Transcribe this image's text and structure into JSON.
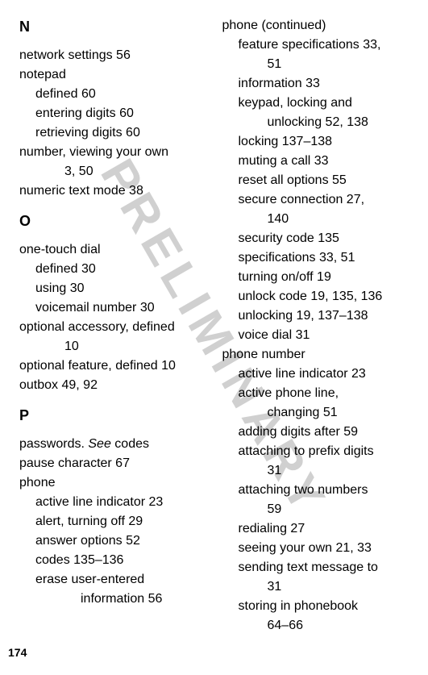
{
  "watermark": "PRELIMINARY",
  "pageNumber": "174",
  "leftColumn": {
    "sectionN": {
      "letter": "N",
      "entries": [
        {
          "text": "network settings  56",
          "class": "entry"
        },
        {
          "text": "notepad",
          "class": "entry"
        },
        {
          "text": "defined  60",
          "class": "sub-entry"
        },
        {
          "text": "entering digits  60",
          "class": "sub-entry"
        },
        {
          "text": "retrieving digits  60",
          "class": "sub-entry"
        },
        {
          "text": "number, viewing your own",
          "class": "entry"
        },
        {
          "text": "3, 50",
          "class": "cont-entry"
        },
        {
          "text": "numeric text mode  38",
          "class": "entry"
        }
      ]
    },
    "sectionO": {
      "letter": "O",
      "entries": [
        {
          "text": "one-touch dial",
          "class": "entry"
        },
        {
          "text": "defined  30",
          "class": "sub-entry"
        },
        {
          "text": "using  30",
          "class": "sub-entry"
        },
        {
          "text": "voicemail number  30",
          "class": "sub-entry"
        },
        {
          "text": "optional accessory, defined",
          "class": "entry"
        },
        {
          "text": "10",
          "class": "cont-entry"
        },
        {
          "text": "optional feature, defined  10",
          "class": "entry"
        },
        {
          "text": "outbox  49, 92",
          "class": "entry"
        }
      ]
    },
    "sectionP": {
      "letter": "P",
      "entries": [
        {
          "text": "passwords. ",
          "italic": "See",
          "after": " codes",
          "class": "entry"
        },
        {
          "text": "pause character  67",
          "class": "entry"
        },
        {
          "text": "phone",
          "class": "entry"
        },
        {
          "text": "active line indicator  23",
          "class": "sub-entry"
        },
        {
          "text": "alert, turning off  29",
          "class": "sub-entry"
        },
        {
          "text": "answer options  52",
          "class": "sub-entry"
        },
        {
          "text": "codes  135–136",
          "class": "sub-entry"
        },
        {
          "text": "erase user-entered",
          "class": "sub-entry"
        },
        {
          "text": "information  56",
          "class": "cont-entry",
          "extraIndent": true
        }
      ]
    }
  },
  "rightColumn": {
    "entries": [
      {
        "text": "phone (continued)",
        "class": "entry"
      },
      {
        "text": "feature specifications  33,",
        "class": "sub-entry"
      },
      {
        "text": "51",
        "class": "cont-entry"
      },
      {
        "text": "information  33",
        "class": "sub-entry"
      },
      {
        "text": "keypad, locking and",
        "class": "sub-entry"
      },
      {
        "text": "unlocking  52, 138",
        "class": "cont-entry"
      },
      {
        "text": "locking  137–138",
        "class": "sub-entry"
      },
      {
        "text": "muting a call  33",
        "class": "sub-entry"
      },
      {
        "text": "reset all options  55",
        "class": "sub-entry"
      },
      {
        "text": "secure connection  27,",
        "class": "sub-entry"
      },
      {
        "text": "140",
        "class": "cont-entry"
      },
      {
        "text": "security code  135",
        "class": "sub-entry"
      },
      {
        "text": "specifications  33, 51",
        "class": "sub-entry"
      },
      {
        "text": "turning on/off  19",
        "class": "sub-entry"
      },
      {
        "text": "unlock code  19, 135, 136",
        "class": "sub-entry"
      },
      {
        "text": "unlocking  19, 137–138",
        "class": "sub-entry"
      },
      {
        "text": "voice dial  31",
        "class": "sub-entry"
      },
      {
        "text": "phone number",
        "class": "entry"
      },
      {
        "text": "active line indicator  23",
        "class": "sub-entry"
      },
      {
        "text": "active phone line,",
        "class": "sub-entry"
      },
      {
        "text": "changing  51",
        "class": "cont-entry"
      },
      {
        "text": "adding digits after  59",
        "class": "sub-entry"
      },
      {
        "text": "attaching to prefix digits",
        "class": "sub-entry"
      },
      {
        "text": "31",
        "class": "cont-entry"
      },
      {
        "text": "attaching two numbers",
        "class": "sub-entry"
      },
      {
        "text": "59",
        "class": "cont-entry"
      },
      {
        "text": "redialing  27",
        "class": "sub-entry"
      },
      {
        "text": "seeing your own  21, 33",
        "class": "sub-entry"
      },
      {
        "text": "sending text message to",
        "class": "sub-entry"
      },
      {
        "text": "31",
        "class": "cont-entry"
      },
      {
        "text": "storing in phonebook",
        "class": "sub-entry"
      },
      {
        "text": "64–66",
        "class": "cont-entry"
      }
    ]
  }
}
